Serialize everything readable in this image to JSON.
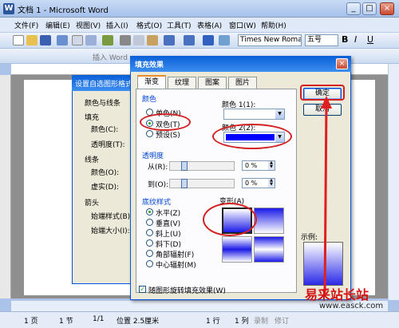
{
  "window": {
    "title": "文档 1 - Microsoft Word",
    "icon": "W"
  },
  "menu": [
    "文件(F)",
    "编辑(E)",
    "视图(V)",
    "插入(I)",
    "格式(O)",
    "工具(T)",
    "表格(A)",
    "窗口(W)",
    "帮助(H)"
  ],
  "toolbar": {
    "font": "Times New Roman",
    "size": "五号",
    "toolbar2_label": "插入 Word"
  },
  "back_dialog": {
    "title": "设置自选图形格式",
    "tab": "颜色与线条",
    "labels": [
      "填充",
      "颜色(C):",
      "透明度(T):",
      "线条",
      "颜色(O):",
      "虚实(D):",
      "箭头",
      "始端样式(B):",
      "始端大小(I):"
    ]
  },
  "dialog": {
    "title": "填充效果",
    "tabs": [
      "渐变",
      "纹理",
      "图案",
      "图片"
    ],
    "colors_group": "颜色",
    "radios": [
      "单色(N)",
      "双色(T)",
      "预设(S)"
    ],
    "color1": "颜色 1(1):",
    "color2": "颜色 2(2):",
    "color2_value": "#0000ff",
    "transparency_group": "透明度",
    "from_label": "从(R):",
    "to_label": "到(O):",
    "from_value": "0 %",
    "to_value": "0 %",
    "shading_group": "底纹样式",
    "shading": [
      "水平(Z)",
      "垂直(V)",
      "斜上(U)",
      "斜下(D)",
      "角部辐射(F)",
      "中心辐射(M)"
    ],
    "variants_label": "变形(A)",
    "ok": "确定",
    "cancel": "取消",
    "sample_label": "示例:",
    "rotate_check": "随图形旋转填充效果(W)"
  },
  "status": {
    "page": "1 页",
    "section": "1 节",
    "pages": "1/1",
    "position": "位置 2.5厘米",
    "line": "1 行",
    "col": "1 列",
    "rec": "录制",
    "rev": "修订"
  },
  "watermark": {
    "text": "易采站长站",
    "url": "www.easck.com"
  }
}
